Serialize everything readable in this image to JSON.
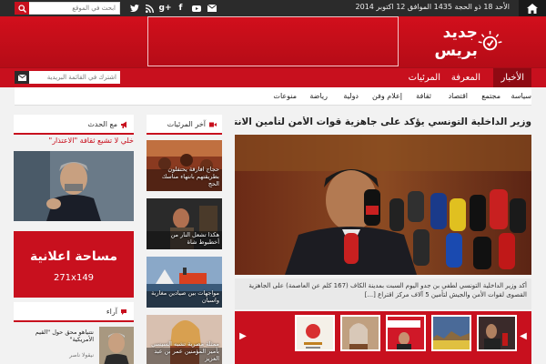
{
  "topbar": {
    "date": "الأحد 18 ذو الحجة 1435 الموافق 12 اكتوبر 2014",
    "search_placeholder": "ابحث في الموقع",
    "social_icons": [
      "mail-icon",
      "youtube-icon",
      "facebook-icon",
      "google-plus-icon",
      "rss-icon",
      "twitter-icon"
    ]
  },
  "header": {
    "logo_text": "جديد بريس"
  },
  "mainnav": {
    "items": [
      {
        "label": "الأخبار"
      },
      {
        "label": "المعرفة"
      },
      {
        "label": "المرئيات"
      }
    ],
    "subscribe_placeholder": "اشترك في القائمة البريدية"
  },
  "subnav": {
    "items": [
      {
        "label": "سياسة"
      },
      {
        "label": "مجتمع"
      },
      {
        "label": "اقتصاد"
      },
      {
        "label": "ثقافة"
      },
      {
        "label": "إعلام وفن"
      },
      {
        "label": "دولية"
      },
      {
        "label": "رياضة"
      },
      {
        "label": "منوعات"
      }
    ]
  },
  "main": {
    "headline": "وزير الداخلية التونسي يؤكد على جاهزية قوات الأمن لتأمين الانتخابات المقبلة",
    "summary": "أكد وزير الداخلية التونسي لطفي بن جدو اليوم السبت بمدينة الكاف (167 كلم عن العاصمة) على الجاهزية القصوى لقوات الأمن والجيش لتأمين 5 آلاف مركز اقتراع [...]"
  },
  "videos": {
    "heading": "آخر المرئيات",
    "items": [
      {
        "caption": "حجاج افارقة يحتفلون بطريقتهم بانتهاء مناسك الحج"
      },
      {
        "caption": "هكذا تشعل النار من أخطبوط شاة"
      },
      {
        "caption": "مواجهات بين صيادين مغاربة واسبان"
      },
      {
        "caption": "ممثلة مصرية تشبه السيسي بأمير المؤمنين عمر بن عبد العزيز"
      }
    ]
  },
  "latest": {
    "heading": "مع الحدث",
    "breaking": "خلي لا تشيع ثقافة \"الاعتذار\""
  },
  "ad": {
    "title": "مساحة اعلانية",
    "size": "271x149"
  },
  "opinion": {
    "heading": "آراء",
    "title": "نتنياهو محق حول \"القيم الأمريكية\"",
    "author": "نيقولا ناصر"
  }
}
